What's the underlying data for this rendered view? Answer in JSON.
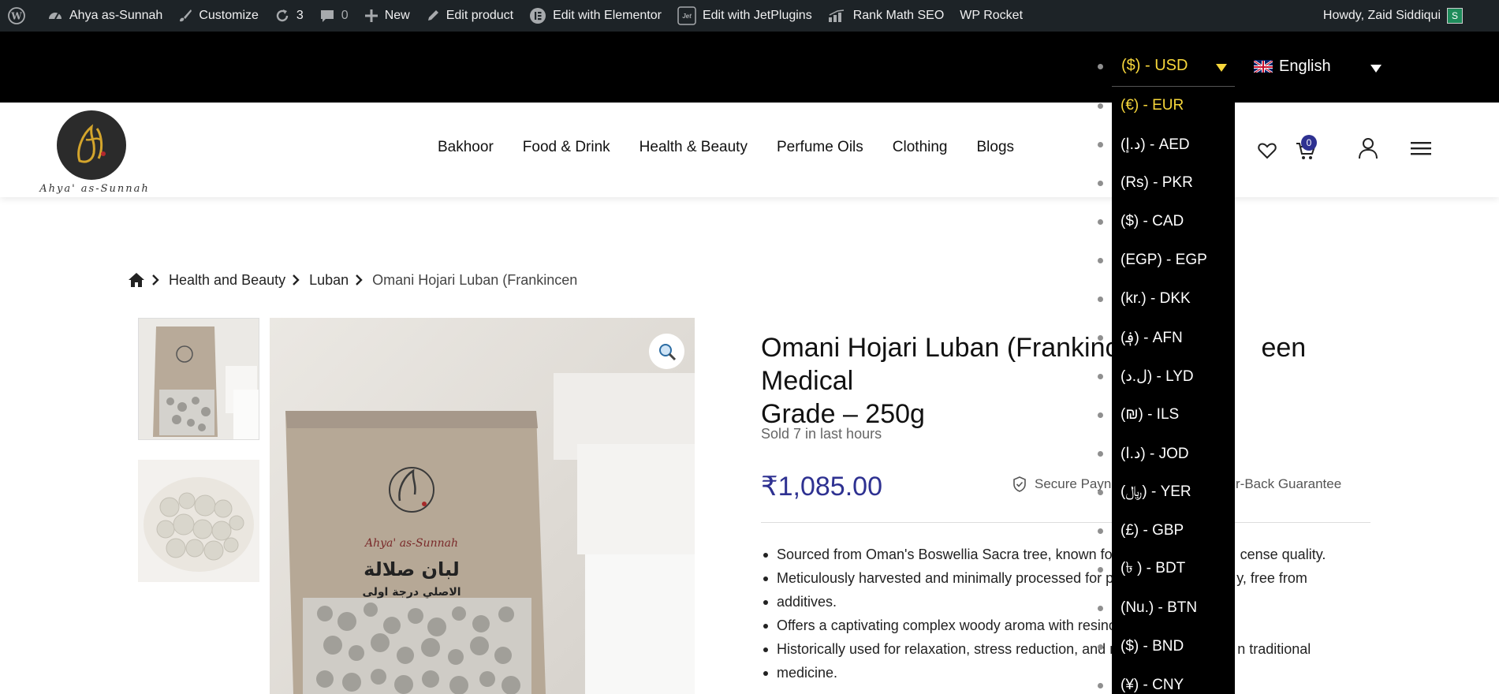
{
  "admin_bar": {
    "site_name": "Ahya as-Sunnah",
    "customize": "Customize",
    "updates_count": "3",
    "comments_count": "0",
    "new": "New",
    "edit_product": "Edit product",
    "edit_elementor": "Edit with Elementor",
    "edit_jetplugins": "Edit with JetPlugins",
    "rank_math": "Rank Math SEO",
    "wp_rocket": "WP Rocket",
    "howdy": "Howdy, Zaid Siddiqui",
    "avatar_letter": "S"
  },
  "currency": {
    "selected": "($) - USD",
    "options": [
      "(€) - EUR",
      "(د.إ) - AED",
      "(Rs) - PKR",
      "($) - CAD",
      "(EGP) - EGP",
      "(kr.) - DKK",
      "(؋) - AFN",
      "(ل.د) - LYD",
      "(₪) - ILS",
      "(د.ا) - JOD",
      "(﷼) - YER",
      "(£) - GBP",
      "(৳ ) - BDT",
      "(Nu.) - BTN",
      "($) - BND",
      "(¥) - CNY"
    ]
  },
  "language": {
    "label": "English"
  },
  "logo": {
    "text": "Ahya' as-Sunnah"
  },
  "nav": {
    "items": [
      "Bakhoor",
      "Food & Drink",
      "Health & Beauty",
      "Perfume Oils",
      "Clothing",
      "Blogs"
    ]
  },
  "cart": {
    "count": "0"
  },
  "breadcrumb": {
    "items": [
      "Health and Beauty",
      "Luban"
    ],
    "current": "Omani Hojari Luban (Frankincen"
  },
  "product": {
    "title_line1": "Omani Hojari Luban (Frankince",
    "title_line1_tail": "een Medical",
    "title_line2": "Grade – 250g",
    "sold": "Sold 7 in last hours",
    "price": "₹1,085.00",
    "secure_left": "Secure Payn",
    "secure_right": "r-Back Guarantee",
    "bullets": [
      [
        "Sourced from Oman's Boswellia Sacra tree, known for",
        "cense quality."
      ],
      [
        "Meticulously harvested and minimally processed for p",
        "y, free from"
      ],
      [
        "additives.",
        ""
      ],
      [
        "Offers a captivating complex woody aroma with resino",
        ""
      ],
      [
        "Historically used for relaxation, stress reduction, and r",
        "n traditional"
      ],
      [
        "medicine.",
        ""
      ]
    ]
  },
  "package_label": {
    "brand": "Ahya' as-Sunnah",
    "arabic_title": "لبان صلالة",
    "arabic_sub": "الاصلي درجة اولى"
  },
  "colors": {
    "accent_yellow": "#f7d73b",
    "price_blue": "#2e3191",
    "admin_bar": "#1d2327"
  }
}
